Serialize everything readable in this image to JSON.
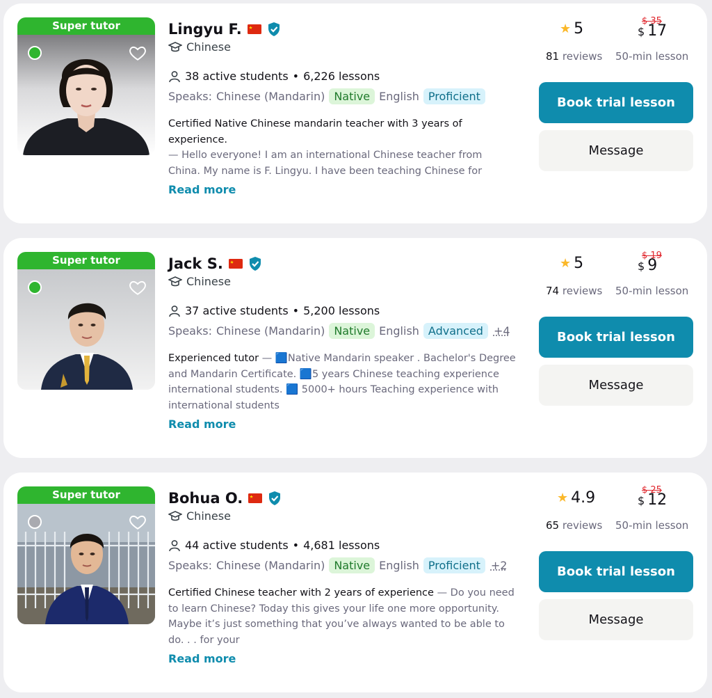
{
  "tutors": [
    {
      "badge": "Super tutor",
      "name": "Lingyu F.",
      "subject": "Chinese",
      "students": "38 active students",
      "lessons": "6,226 lessons",
      "speaks_label": "Speaks:",
      "native_lang": "Chinese (Mandarin)",
      "native_level": "Native",
      "second_lang": "English",
      "second_level": "Proficient",
      "more_langs": "",
      "headline": "Certified Native Chinese mandarin teacher with 3 years of experience.",
      "body": "— Hello everyone! I am an international Chinese teacher from China. My name is F. Lingyu. I have been teaching Chinese for",
      "read_more": "Read more",
      "rating": "5",
      "reviews_count": "81",
      "reviews_label": "reviews",
      "old_price": "$ 35",
      "currency": "$",
      "price": "17",
      "lesson_label": "50-min lesson",
      "book_label": "Book trial lesson",
      "message_label": "Message",
      "online_color": "#2fb52f"
    },
    {
      "badge": "Super tutor",
      "name": "Jack S.",
      "subject": "Chinese",
      "students": "37 active students",
      "lessons": "5,200 lessons",
      "speaks_label": "Speaks:",
      "native_lang": "Chinese (Mandarin)",
      "native_level": "Native",
      "second_lang": "English",
      "second_level": "Advanced",
      "more_langs": "+4",
      "headline": "Experienced tutor",
      "body": "— 🟦Native Mandarin speaker . Bachelor's Degree and Mandarin Certificate. 🟦5 years Chinese teaching experience international students. 🟦 5000+ hours Teaching experience with international students",
      "read_more": "Read more",
      "rating": "5",
      "reviews_count": "74",
      "reviews_label": "reviews",
      "old_price": "$ 19",
      "currency": "$",
      "price": "9",
      "lesson_label": "50-min lesson",
      "book_label": "Book trial lesson",
      "message_label": "Message",
      "online_color": "#2fb52f"
    },
    {
      "badge": "Super tutor",
      "name": "Bohua O.",
      "subject": "Chinese",
      "students": "44 active students",
      "lessons": "4,681 lessons",
      "speaks_label": "Speaks:",
      "native_lang": "Chinese (Mandarin)",
      "native_level": "Native",
      "second_lang": "English",
      "second_level": "Proficient",
      "more_langs": "+2",
      "headline": "Certified Chinese teacher with 2 years of experience",
      "body": "— Do you need to learn Chinese? Today this gives your life one more opportunity. Maybe it’s just something that you’ve always wanted to be able to do. . . for your",
      "read_more": "Read more",
      "rating": "4.9",
      "reviews_count": "65",
      "reviews_label": "reviews",
      "old_price": "$ 25",
      "currency": "$",
      "price": "12",
      "lesson_label": "50-min lesson",
      "book_label": "Book trial lesson",
      "message_label": "Message",
      "online_color": "#a9aab0"
    }
  ],
  "icons": {
    "heart": "heart-icon",
    "verified": "verified-badge-icon",
    "flag": "china-flag-icon",
    "graduation": "graduation-cap-icon",
    "person": "person-icon",
    "star": "star-icon"
  },
  "colors": {
    "brand": "#0f8cad",
    "super_tutor": "#2fb52f",
    "discount": "#e0262d",
    "star": "#fbb829"
  }
}
